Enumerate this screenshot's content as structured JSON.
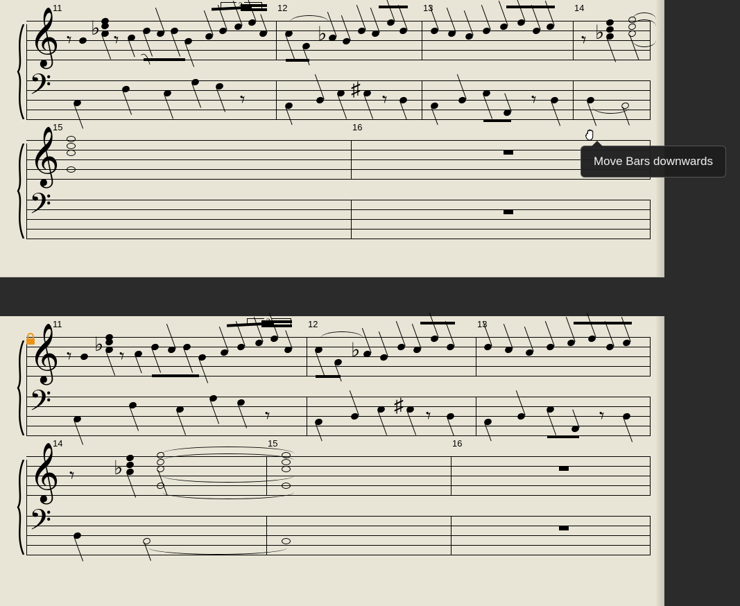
{
  "tooltip": {
    "text": "Move Bars downwards"
  },
  "top_panel": {
    "systems": [
      {
        "bars": [
          {
            "num": "11"
          },
          {
            "num": "12"
          },
          {
            "num": "13"
          },
          {
            "num": "14"
          }
        ],
        "triplet": "3"
      },
      {
        "bars": [
          {
            "num": "15"
          },
          {
            "num": "16"
          }
        ]
      }
    ]
  },
  "bottom_panel": {
    "locked": true,
    "systems": [
      {
        "bars": [
          {
            "num": "11"
          },
          {
            "num": "12"
          },
          {
            "num": "13"
          }
        ],
        "triplet": "3"
      },
      {
        "bars": [
          {
            "num": "14"
          },
          {
            "num": "15"
          },
          {
            "num": "16"
          }
        ]
      }
    ]
  }
}
